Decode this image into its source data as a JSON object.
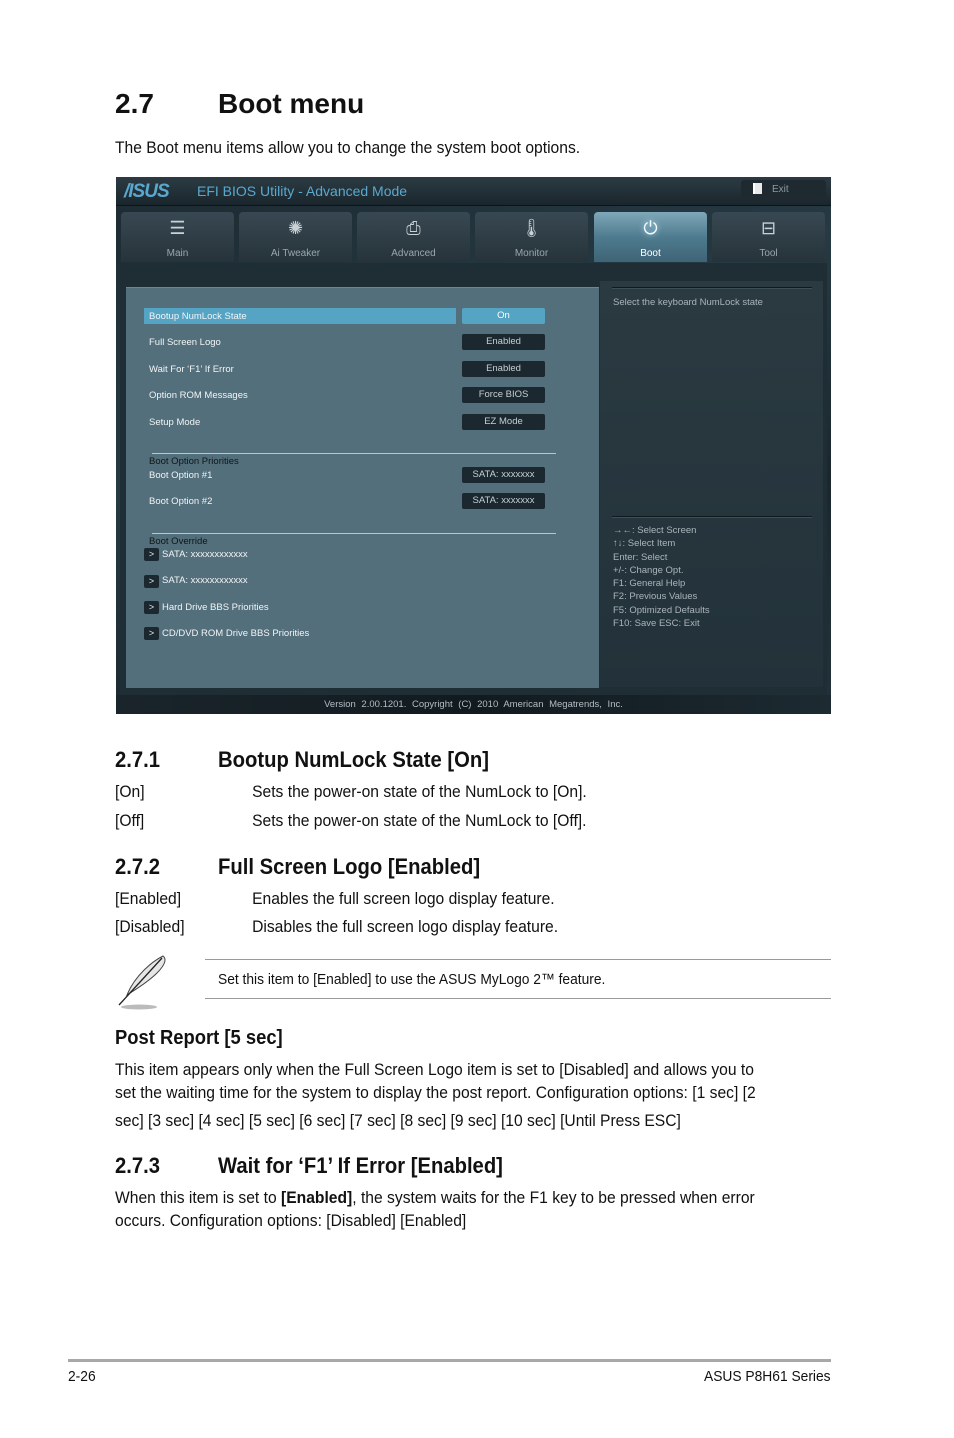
{
  "section": {
    "number": "2.7",
    "title": "Boot menu",
    "intro": "The Boot menu items allow you to change the system boot options."
  },
  "bios": {
    "brand": "/ISUS",
    "title": "EFI BIOS Utility - Advanced Mode",
    "exit_label": "Exit",
    "tabs": [
      {
        "label": "Main",
        "icon": "list-icon",
        "glyph": "☰"
      },
      {
        "label": "Ai  Tweaker",
        "icon": "fan-icon",
        "glyph": "✺"
      },
      {
        "label": "Advanced",
        "icon": "advanced-settings-icon",
        "glyph": "⎙"
      },
      {
        "label": "Monitor",
        "icon": "thermometer-icon",
        "glyph": "🌡"
      },
      {
        "label": "Boot",
        "icon": "power-icon",
        "glyph": "⏻",
        "active": true
      },
      {
        "label": "Tool",
        "icon": "toolbox-icon",
        "glyph": "⊟"
      }
    ],
    "settings": [
      {
        "label": "Bootup NumLock State",
        "value": "On",
        "selected": true
      },
      {
        "label": "Full Screen Logo",
        "value": "Enabled"
      },
      {
        "label": "Wait For ‘F1’ If Error",
        "value": "Enabled"
      },
      {
        "label": "Option ROM Messages",
        "value": "Force BIOS"
      },
      {
        "label": "Setup Mode",
        "value": "EZ Mode"
      }
    ],
    "boot_priorities": {
      "title": "Boot Option Priorities",
      "items": [
        {
          "label": "Boot Option #1",
          "value": "SATA: xxxxxxx"
        },
        {
          "label": "Boot Option #2",
          "value": "SATA: xxxxxxx"
        }
      ]
    },
    "boot_override": {
      "title": "Boot Override",
      "arrow": ">",
      "items": [
        "SATA: xxxxxxxxxxxx",
        "SATA: xxxxxxxxxxxx",
        "Hard Drive BBS Priorities",
        "CD/DVD ROM Drive BBS Priorities"
      ]
    },
    "help_text": "Select the keyboard NumLock state",
    "keys": [
      "→←:  Select Screen",
      "↑↓:  Select Item",
      "Enter:  Select",
      "+/-:  Change Opt.",
      "F1:  General Help",
      "F2:  Previous Values",
      "F5:  Optimized Defaults",
      "F10:  Save    ESC:  Exit"
    ],
    "version": "Version  2.00.1201.  Copyright  (C)  2010  American  Megatrends,  Inc."
  },
  "s271": {
    "number": "2.7.1",
    "title": "Bootup NumLock State [On]",
    "options": [
      {
        "term": "[On]",
        "desc": "Sets the power-on state of the NumLock to [On]."
      },
      {
        "term": "[Off]",
        "desc": "Sets the power-on state of the NumLock to [Off]."
      }
    ]
  },
  "s272": {
    "number": "2.7.2",
    "title": "Full Screen Logo [Enabled]",
    "options": [
      {
        "term": "[Enabled]",
        "desc": "Enables the full screen logo display feature."
      },
      {
        "term": "[Disabled]",
        "desc": "Disables the full screen logo display feature."
      }
    ],
    "note": "Set this item to [Enabled] to use the ASUS MyLogo 2™ feature."
  },
  "post_report": {
    "title": "Post Report [5 sec]",
    "lines": [
      "This item appears only when the Full Screen Logo item is set to [Disabled] and allows you to",
      "set the waiting time for the system to display the post report. Configuration options: [1 sec] [2",
      "sec] [3 sec] [4 sec] [5 sec] [6 sec] [7 sec] [8 sec] [9 sec] [10 sec] [Until Press ESC]"
    ]
  },
  "s273": {
    "number": "2.7.3",
    "title": "Wait for ‘F1’ If Error [Enabled]",
    "line1_pre": "When this item is set to ",
    "line1_bold": "[Enabled]",
    "line1_post": ", the system waits for the F1 key to be pressed when error",
    "line2": "occurs. Configuration options: [Disabled] [Enabled]"
  },
  "footer": {
    "page": "2-26",
    "product": "ASUS P8H61 Series"
  }
}
